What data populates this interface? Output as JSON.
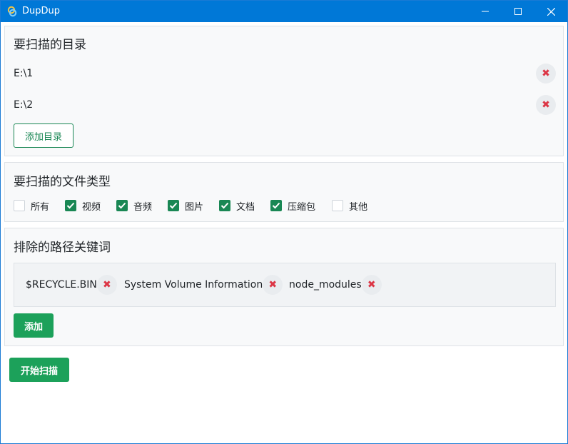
{
  "window": {
    "title": "DupDup"
  },
  "directories": {
    "title": "要扫描的目录",
    "items": [
      {
        "path": "E:\\1"
      },
      {
        "path": "E:\\2"
      }
    ],
    "add_label": "添加目录"
  },
  "file_types": {
    "title": "要扫描的文件类型",
    "items": [
      {
        "label": "所有",
        "checked": false
      },
      {
        "label": "视频",
        "checked": true
      },
      {
        "label": "音频",
        "checked": true
      },
      {
        "label": "图片",
        "checked": true
      },
      {
        "label": "文档",
        "checked": true
      },
      {
        "label": "压缩包",
        "checked": true
      },
      {
        "label": "其他",
        "checked": false
      }
    ]
  },
  "exclude": {
    "title": "排除的路径关键词",
    "keywords": [
      "$RECYCLE.BIN",
      "System Volume Information",
      "node_modules"
    ],
    "add_label": "添加"
  },
  "start_label": "开始扫描",
  "colors": {
    "titlebar": "#0078d7",
    "accent": "#198754",
    "remove": "#dc3545"
  }
}
